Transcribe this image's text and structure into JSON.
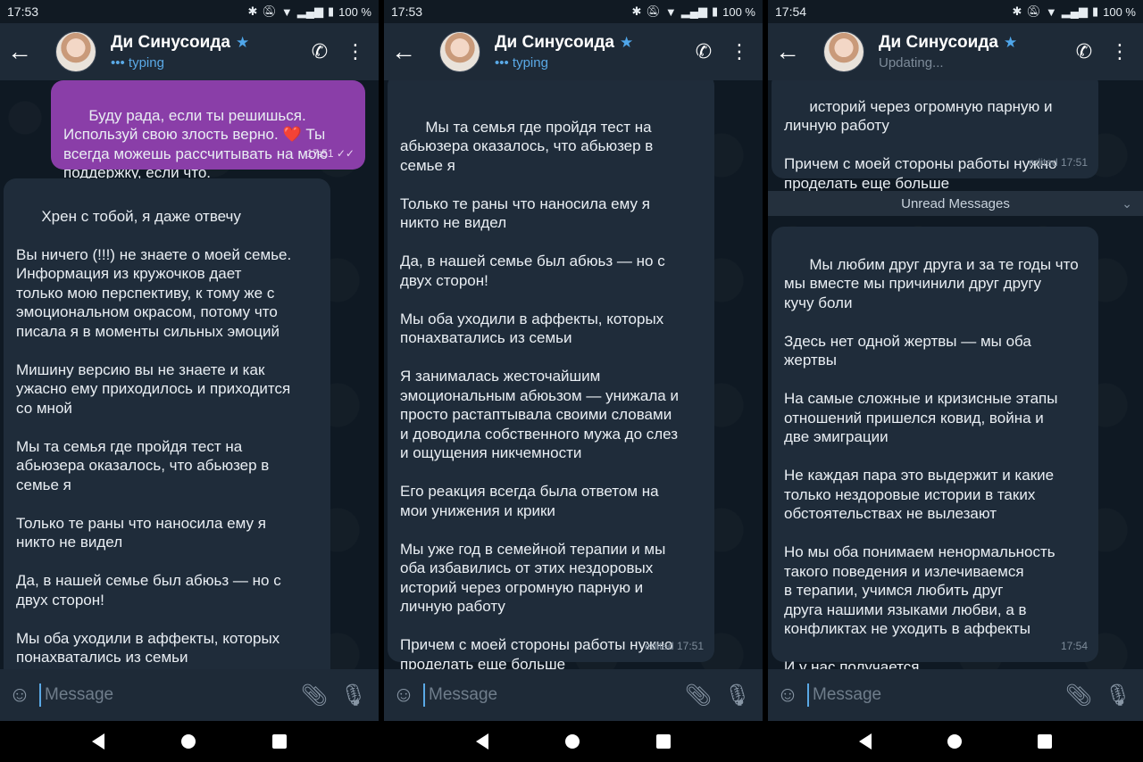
{
  "panels": [
    {
      "status": {
        "time": "17:53",
        "battery": "100 %"
      },
      "header": {
        "name": "Ди Синусоида",
        "status": "••• typing"
      },
      "composer": {
        "placeholder": "Message"
      },
      "bubbles": [
        {
          "text": "Буду рада, если ты решишься.\nИспользуй свою злость верно. ❤️ Ты\nвсегда можешь рассчитывать на мою\nподдержку, если что.",
          "meta": "17:51 ✓✓"
        },
        {
          "text": "Хрен с тобой, я даже отвечу\n\nВы ничего (!!!) не знаете о моей семье.\nИнформация из кружочков дает\nтолько мою перспективу, к тому же с\nэмоциональном окрасом, потому что\nписала я в моменты сильных эмоций\n\nМишину версию вы не знаете и как\nужасно ему приходилось и приходится\nсо мной\n\nМы та семья где пройдя тест на\nабьюзера оказалось, что абьюзер в\nсемье я\n\nТолько те раны что наносила ему я\nникто не видел\n\nДа, в нашей семье был абюьз — но с\nдвух сторон!\n\nМы оба уходили в аффекты, которых\nпонахватались из семьи\n\nЯ занималась жесточайшим",
          "meta": ""
        }
      ]
    },
    {
      "status": {
        "time": "17:53",
        "battery": "100 %"
      },
      "header": {
        "name": "Ди Синусоида",
        "status": "••• typing"
      },
      "composer": {
        "placeholder": "Message"
      },
      "bubbles": [
        {
          "text": "Мы та семья где пройдя тест на\nабьюзера оказалось, что абьюзер в\nсемье я\n\nТолько те раны что наносила ему я\nникто не видел\n\nДа, в нашей семье был абюьз — но с\nдвух сторон!\n\nМы оба уходили в аффекты, которых\nпонахватались из семьи\n\nЯ занималась жесточайшим\nэмоциональным абюьзом — унижала и\nпросто растаптывала своими словами\nи доводила собственного мужа до слез\nи ощущения никчемности\n\nЕго реакция всегда была ответом на\nмои унижения и крики\n\nМы уже год в семейной терапии и мы\nоба избавились от этих нездоровых\nисторий через огромную парную и\nличную работу\n\nПричем с моей стороны работы нужно\nпроделать еще больше",
          "meta": "edited 17:51"
        }
      ]
    },
    {
      "status": {
        "time": "17:54",
        "battery": "100 %"
      },
      "header": {
        "name": "Ди Синусоида",
        "status": "Updating..."
      },
      "composer": {
        "placeholder": "Message"
      },
      "unread_label": "Unread Messages",
      "bubbles": [
        {
          "text": "историй через огромную парную и\nличную работу\n\nПричем с моей стороны работы нужно\nпроделать еще больше",
          "meta": "edited 17:51"
        },
        {
          "text": "Мы любим друг друга и за те годы что\nмы вместе мы причинили друг другу\nкучу боли\n\nЗдесь нет одной жертвы — мы оба\nжертвы\n\nНа самые сложные и кризисные этапы\nотношений пришелся ковид, война и\nдве эмиграции\n\nНе каждая пара это выдержит и какие\nтолько нездоровые истории в таких\nобстоятельствах не вылезают\n\nНо мы оба понимаем ненормальность\nтакого поведения и излечиваемся\nв терапии, учимся любить друг\nдруга нашими языками любви, а в\nконфликтах не уходить в аффекты\n\nИ у нас получается",
          "meta": "17:54"
        }
      ]
    }
  ]
}
